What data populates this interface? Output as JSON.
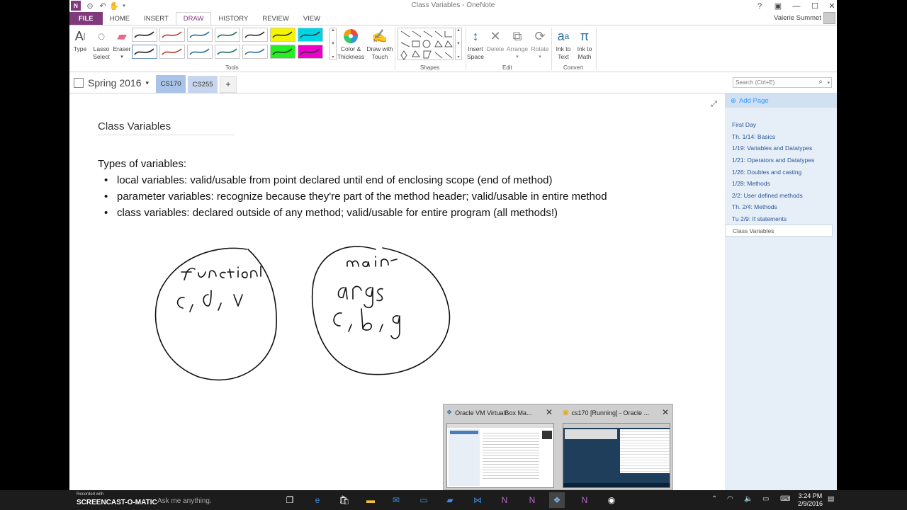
{
  "window": {
    "title": "Class Variables - OneNote",
    "user": "Valerie Summet"
  },
  "ribbon": {
    "tabs": [
      "FILE",
      "HOME",
      "INSERT",
      "DRAW",
      "HISTORY",
      "REVIEW",
      "VIEW"
    ],
    "active_tab": "DRAW",
    "tools": {
      "type": "Type",
      "lasso": "Lasso\nSelect",
      "eraser": "Eraser",
      "color_thickness": "Color &\nThickness",
      "draw_with_touch": "Draw with\nTouch",
      "insert_space": "Insert\nSpace",
      "delete": "Delete",
      "arrange": "Arrange",
      "rotate": "Rotate",
      "ink_to_text": "Ink to\nText",
      "ink_to_math": "Ink to\nMath"
    },
    "groups": {
      "tools": "Tools",
      "shapes": "Shapes",
      "edit": "Edit",
      "convert": "Convert"
    },
    "pen_colors": [
      "#222222",
      "#c0392b",
      "#2e6f9e",
      "#1f6f5c",
      "#333333",
      "#f5f500",
      "#00d5e6",
      "#222222",
      "#c0392b",
      "#2e6f9e",
      "#1f6f5c",
      "#2e6f9e",
      "#22ee22",
      "#ee00cc"
    ]
  },
  "notebook": {
    "name": "Spring 2016",
    "sections": [
      "CS170",
      "CS255"
    ],
    "active_section": "CS170",
    "add_section": "+",
    "search_placeholder": "Search (Ctrl+E)"
  },
  "pages": {
    "add_page": "Add Page",
    "items": [
      "First Day",
      "Th. 1/14: Basics",
      "1/19: Variables and Datatypes",
      "1/21: Operators and Datatypes",
      "1/26: Doubles and casting",
      "1/28: Methods",
      "2/2: User defined methods",
      "Th. 2/4: Methods",
      "Tu 2/9: If statements",
      "Class Variables"
    ],
    "selected": "Class Variables"
  },
  "page": {
    "title": "Class Variables",
    "intro": "Types of variables:",
    "bullets": [
      "local variables: valid/usable from point declared until end of enclosing scope (end of method)",
      "parameter variables: recognize because they're part of the method header; valid/usable in entire method",
      "class variables: declared outside of any method; valid/usable for entire program (all methods!)"
    ]
  },
  "thumbnails": [
    {
      "title": "Oracle VM VirtualBox Ma..."
    },
    {
      "title": "cs170 [Running] - Oracle ..."
    }
  ],
  "taskbar": {
    "watermark": "SCREENCAST-O-MATIC",
    "watermark_top": "Recorded with",
    "search": "Ask me anything.",
    "time": "3:24 PM",
    "date": "2/9/2016"
  }
}
